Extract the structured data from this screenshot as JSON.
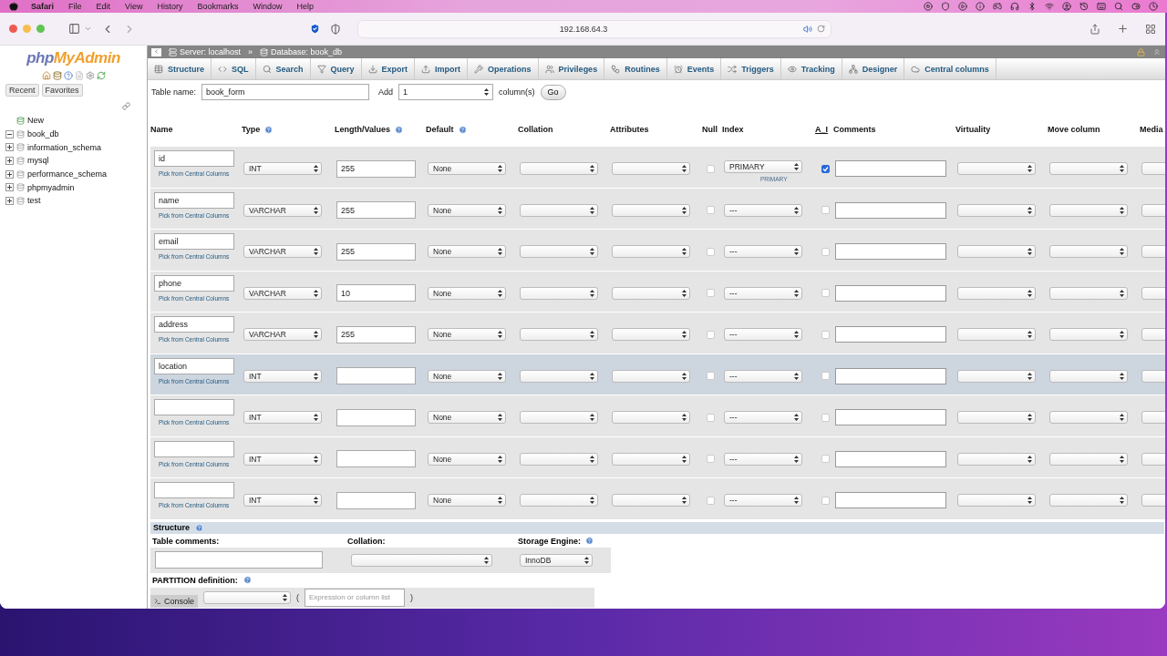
{
  "menubar": {
    "app": "Safari",
    "items": [
      "File",
      "Edit",
      "View",
      "History",
      "Bookmarks",
      "Window",
      "Help"
    ]
  },
  "browser": {
    "url": "192.168.64.3"
  },
  "sidebar": {
    "logo": [
      "php",
      "MyAdmin"
    ],
    "tabs": [
      "Recent",
      "Favorites"
    ],
    "tree": [
      {
        "label": "New",
        "kind": "new"
      },
      {
        "label": "book_db",
        "kind": "db",
        "expanded": true
      },
      {
        "label": "information_schema",
        "kind": "db",
        "expanded": false
      },
      {
        "label": "mysql",
        "kind": "db",
        "expanded": false
      },
      {
        "label": "performance_schema",
        "kind": "db",
        "expanded": false
      },
      {
        "label": "phpmyadmin",
        "kind": "db",
        "expanded": false
      },
      {
        "label": "test",
        "kind": "db",
        "expanded": false
      }
    ]
  },
  "breadcrumb": [
    "Server: localhost",
    "Database: book_db"
  ],
  "breadcrumb_separator": "»",
  "tabs": [
    "Structure",
    "SQL",
    "Search",
    "Query",
    "Export",
    "Import",
    "Operations",
    "Privileges",
    "Routines",
    "Events",
    "Triggers",
    "Tracking",
    "Designer",
    "Central columns"
  ],
  "form": {
    "table_name_label": "Table name:",
    "table_name": "book_form",
    "add_label": "Add",
    "add_value": "1",
    "columns_label": "column(s)",
    "go": "Go"
  },
  "columns": [
    {
      "label": "Name",
      "help": false
    },
    {
      "label": "Type",
      "help": true
    },
    {
      "label": "Length/Values",
      "help": true
    },
    {
      "label": "Default",
      "help": true
    },
    {
      "label": "Collation",
      "help": false
    },
    {
      "label": "Attributes",
      "help": false
    },
    {
      "label": "Null",
      "help": false
    },
    {
      "label": "Index",
      "help": false
    },
    {
      "label": "A_I",
      "help": false
    },
    {
      "label": "Comments",
      "help": false
    },
    {
      "label": "Virtuality",
      "help": false
    },
    {
      "label": "Move column",
      "help": false
    },
    {
      "label": "Media"
    }
  ],
  "rows": [
    {
      "name": "id",
      "pick": "Pick from Central Columns",
      "type": "INT",
      "length": "255",
      "default": "None",
      "null": false,
      "index": "PRIMARY",
      "index_note": "PRIMARY",
      "ai": true,
      "highlighted": false
    },
    {
      "name": "name",
      "pick": "Pick from Central Columns",
      "type": "VARCHAR",
      "length": "255",
      "default": "None",
      "null": false,
      "index": "---",
      "ai": false,
      "highlighted": false
    },
    {
      "name": "email",
      "pick": "Pick from Central Columns",
      "type": "VARCHAR",
      "length": "255",
      "default": "None",
      "null": false,
      "index": "---",
      "ai": false,
      "highlighted": false
    },
    {
      "name": "phone",
      "pick": "Pick from Central Columns",
      "type": "VARCHAR",
      "length": "10",
      "default": "None",
      "null": false,
      "index": "---",
      "ai": false,
      "highlighted": false
    },
    {
      "name": "address",
      "pick": "Pick from Central Columns",
      "type": "VARCHAR",
      "length": "255",
      "default": "None",
      "null": false,
      "index": "---",
      "ai": false,
      "highlighted": false
    },
    {
      "name": "location",
      "pick": "Pick from Central Columns",
      "type": "INT",
      "default": "None",
      "null": false,
      "index": "---",
      "ai": false,
      "highlighted": true
    },
    {
      "pick": "Pick from Central Columns",
      "type": "INT",
      "default": "None",
      "null": false,
      "index": "---",
      "ai": false,
      "highlighted": false
    },
    {
      "pick": "Pick from Central Columns",
      "type": "INT",
      "default": "None",
      "null": false,
      "index": "---",
      "ai": false,
      "highlighted": false
    },
    {
      "pick": "Pick from Central Columns",
      "type": "INT",
      "default": "None",
      "null": false,
      "index": "---",
      "ai": false,
      "highlighted": false
    }
  ],
  "structure": {
    "title": "Structure",
    "comments_label": "Table comments:",
    "collation_label": "Collation:",
    "engine_label": "Storage Engine:",
    "engine": "InnoDB",
    "partition_label": "PARTITION definition:",
    "open_paren": "(",
    "expression_placeholder": "Expression or column list",
    "close_paren": ")"
  },
  "console": "Console"
}
